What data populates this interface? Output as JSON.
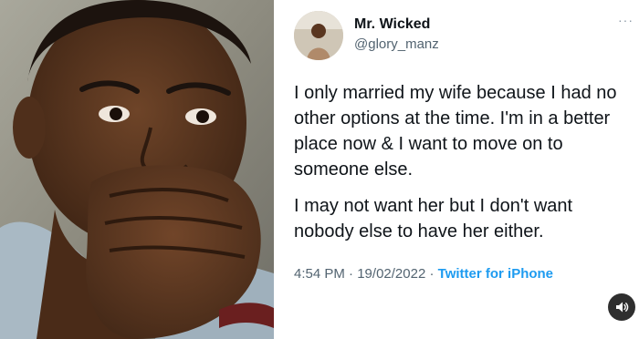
{
  "tweet": {
    "display_name": "Mr. Wicked",
    "handle": "@glory_manz",
    "more_label": "···",
    "paragraph_1": "I only married my wife because I had no other options at the time. I'm in a better place now & I want to move on to someone else.",
    "paragraph_2": "I may not want her but I don't want nobody else to have her either.",
    "time": "4:54 PM",
    "separator": " · ",
    "date": "19/02/2022",
    "source": "Twitter for iPhone"
  },
  "colors": {
    "text": "#0f1419",
    "muted": "#536471",
    "link": "#1d9bf0",
    "skin": "#5a3620"
  },
  "icons": {
    "sound": "speaker-icon",
    "more": "more-dots-icon"
  }
}
